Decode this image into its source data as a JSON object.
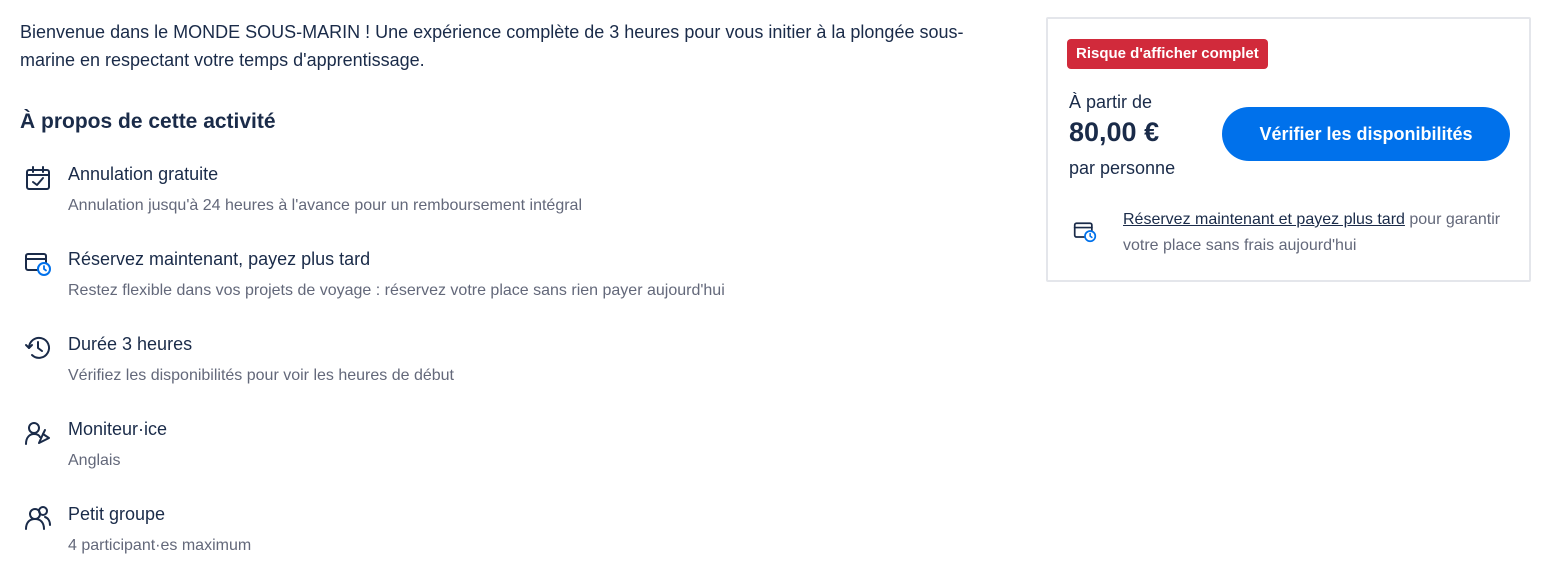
{
  "intro": {
    "text": "Bienvenue dans le MONDE SOUS-MARIN ! Une expérience complète de 3 heures pour vous initier à la plongée sous-marine en respectant votre temps d'apprentissage."
  },
  "about": {
    "title": "À propos de cette activité",
    "features": [
      {
        "icon": "calendar-check-icon",
        "title": "Annulation gratuite",
        "desc": "Annulation jusqu'à 24 heures à l'avance pour un remboursement intégral"
      },
      {
        "icon": "card-clock-icon",
        "title": "Réservez maintenant, payez plus tard",
        "desc": "Restez flexible dans vos projets de voyage : réservez votre place sans rien payer aujourd'hui"
      },
      {
        "icon": "clock-history-icon",
        "title": "Durée 3 heures",
        "desc": "Vérifiez les disponibilités pour voir les heures de début"
      },
      {
        "icon": "guide-icon",
        "title": "Moniteur·ice",
        "desc": "Anglais"
      },
      {
        "icon": "group-icon",
        "title": "Petit groupe",
        "desc": "4 participant·es maximum"
      }
    ]
  },
  "booking": {
    "badge": "Risque d'afficher complet",
    "from_label": "À partir de",
    "price": "80,00 €",
    "per_person": "par personne",
    "cta_label": "Vérifier les disponibilités",
    "note_link": "Réservez maintenant et payez plus tard",
    "note_text": " pour garantir votre place sans frais aujourd'hui"
  },
  "colors": {
    "text": "#1a2b49",
    "muted": "#63687a",
    "accent": "#0071eb",
    "badge": "#d12a3b"
  }
}
